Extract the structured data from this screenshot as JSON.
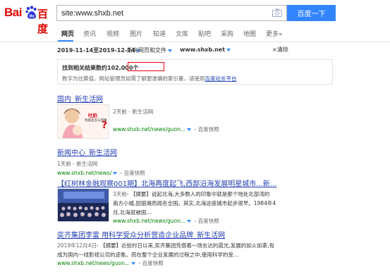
{
  "logo": {
    "part1": "Bai",
    "part2": "百度",
    "paw_text": "du"
  },
  "search": {
    "value": "site:www.shxb.net",
    "button": "百度一下"
  },
  "tabs": [
    {
      "label": "网页"
    },
    {
      "label": "资讯"
    },
    {
      "label": "视频"
    },
    {
      "label": "图片"
    },
    {
      "label": "知道"
    },
    {
      "label": "文库"
    },
    {
      "label": "贴吧"
    },
    {
      "label": "采购"
    },
    {
      "label": "地图"
    },
    {
      "label": "更多»"
    }
  ],
  "filters": {
    "date_range": "2019-11-14至2019-12-14",
    "type": "所有网页和文件",
    "site": "www.shxb.net",
    "clear": "×清除"
  },
  "tip": {
    "prefix": "找到相关结果数约",
    "count": "102,000个",
    "line2_text": "数字为估算值。网站管理员如需了解更准确的索引量，请使用",
    "line2_link": "百度站长平台"
  },
  "results": [
    {
      "title": "国内_新生活网",
      "meta": "2天前 - 新生活网",
      "url": "www.shxb.net/news/guon...",
      "snapshot": "百度快照",
      "thumb_text_1": "吐奶",
      "thumb_text_2": "到底是怎么回事"
    },
    {
      "title": "新闻中心_新生活网",
      "meta": "1天前 - 新生活网",
      "url": "www.shxb.net/news/",
      "snapshot": "百度快照"
    },
    {
      "title": "【红树林金融观察001期】北海再度起飞,西部沿海发展明星城市...新...",
      "date": "3天前",
      "abstract_1": "- 【摘要】说起北海,大多数人的印象中就是那个地处北部湾的",
      "abstract_2": "南方小城,因银滩而闻名全国。其实,北海这座城市起步很早。1984年4",
      "abstract_3": "月,北海就被国...",
      "url": "www.shxb.net/news/guon...",
      "snapshot": "百度快照"
    },
    {
      "title": "奕齐集团李雷 用科学受众分析营造企业品牌_新生活网",
      "date": "2019年12月4日",
      "abstract_1": "- 【摘要】近些时日以来,奕齐集团凭借着一场长达的晨光,发展的如火如荼,有",
      "abstract_2": "成为国内一线影视公司的迹象。而在整个企业发展的过程之中,使用科学的受...",
      "url": "www.shxb.net/news/guon...",
      "snapshot": "百度快照"
    }
  ]
}
